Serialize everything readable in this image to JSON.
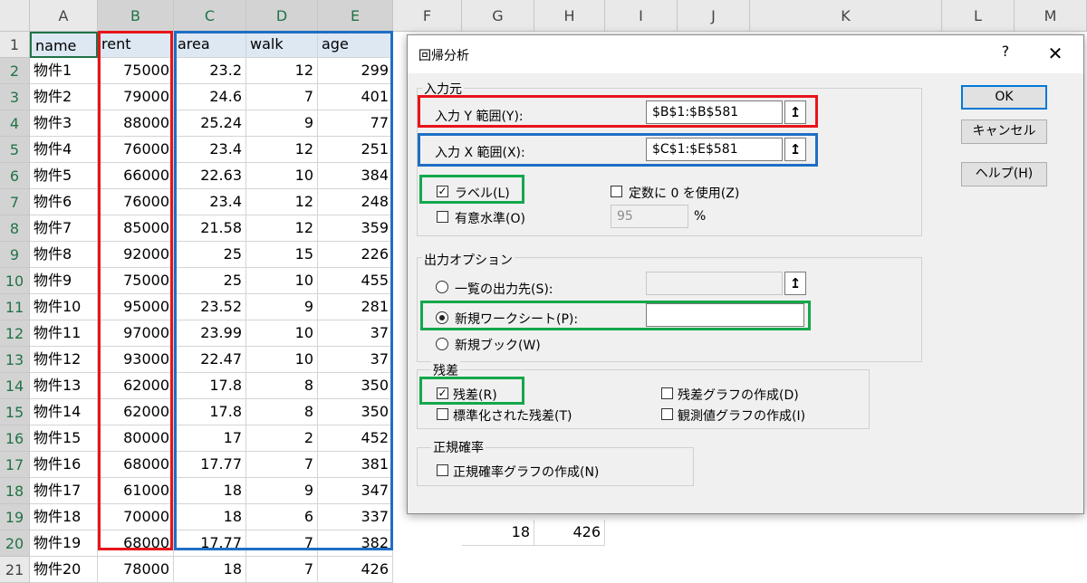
{
  "sheet": {
    "columns": [
      "A",
      "B",
      "C",
      "D",
      "E",
      "F",
      "G",
      "H",
      "I",
      "J",
      "K",
      "L",
      "M"
    ],
    "headers": [
      "name",
      "rent",
      "area",
      "walk",
      "age"
    ],
    "rows": [
      [
        "物件1",
        "75000",
        "23.2",
        "12",
        "299"
      ],
      [
        "物件2",
        "79000",
        "24.6",
        "7",
        "401"
      ],
      [
        "物件3",
        "88000",
        "25.24",
        "9",
        "77"
      ],
      [
        "物件4",
        "76000",
        "23.4",
        "12",
        "251"
      ],
      [
        "物件5",
        "66000",
        "22.63",
        "10",
        "384"
      ],
      [
        "物件6",
        "76000",
        "23.4",
        "12",
        "248"
      ],
      [
        "物件7",
        "85000",
        "21.58",
        "12",
        "359"
      ],
      [
        "物件8",
        "92000",
        "25",
        "15",
        "226"
      ],
      [
        "物件9",
        "75000",
        "25",
        "10",
        "455"
      ],
      [
        "物件10",
        "95000",
        "23.52",
        "9",
        "281"
      ],
      [
        "物件11",
        "97000",
        "23.99",
        "10",
        "37"
      ],
      [
        "物件12",
        "93000",
        "22.47",
        "10",
        "37"
      ],
      [
        "物件13",
        "62000",
        "17.8",
        "8",
        "350"
      ],
      [
        "物件14",
        "62000",
        "17.8",
        "8",
        "350"
      ],
      [
        "物件15",
        "80000",
        "17",
        "2",
        "452"
      ],
      [
        "物件16",
        "68000",
        "17.77",
        "7",
        "381"
      ],
      [
        "物件17",
        "61000",
        "18",
        "9",
        "347"
      ],
      [
        "物件18",
        "70000",
        "18",
        "6",
        "337"
      ],
      [
        "物件19",
        "68000",
        "17.77",
        "7",
        "382"
      ],
      [
        "物件20",
        "78000",
        "18",
        "7",
        "426"
      ]
    ],
    "row_numbers": [
      "1",
      "2",
      "3",
      "4",
      "5",
      "6",
      "7",
      "8",
      "9",
      "10",
      "11",
      "12",
      "13",
      "14",
      "15",
      "16",
      "17",
      "18",
      "19",
      "20",
      "21"
    ],
    "behind_dialog": {
      "g21": "18",
      "h21": "426"
    }
  },
  "dialog": {
    "title": "回帰分析",
    "help_glyph": "?",
    "close_glyph": "✕",
    "input_group": "入力元",
    "y_range_label": "入力 Y 範囲(Y):",
    "y_range_value": "$B$1:$B$581",
    "x_range_label": "入力 X 範囲(X):",
    "x_range_value": "$C$1:$E$581",
    "ref_glyph": "↥",
    "label_check": "ラベル(L)",
    "const_zero": "定数に 0 を使用(Z)",
    "confidence": "有意水準(O)",
    "confidence_value": "95",
    "percent": "%",
    "output_group": "出力オプション",
    "output_range": "一覧の出力先(S):",
    "new_sheet": "新規ワークシート(P):",
    "new_book": "新規ブック(W)",
    "residual_group": "残差",
    "residuals": "残差(R)",
    "residual_plots": "残差グラフの作成(D)",
    "std_residuals": "標準化された残差(T)",
    "line_fit": "観測値グラフの作成(I)",
    "normal_group": "正規確率",
    "normal_plots": "正規確率グラフの作成(N)",
    "ok": "OK",
    "cancel": "キャンセル",
    "help": "ヘルプ(H)",
    "check_glyph": "✓"
  },
  "colors": {
    "red_box": "#e8141b",
    "blue_box": "#1e6fc4",
    "green_box": "#12a84a",
    "excel_green": "#217346"
  }
}
